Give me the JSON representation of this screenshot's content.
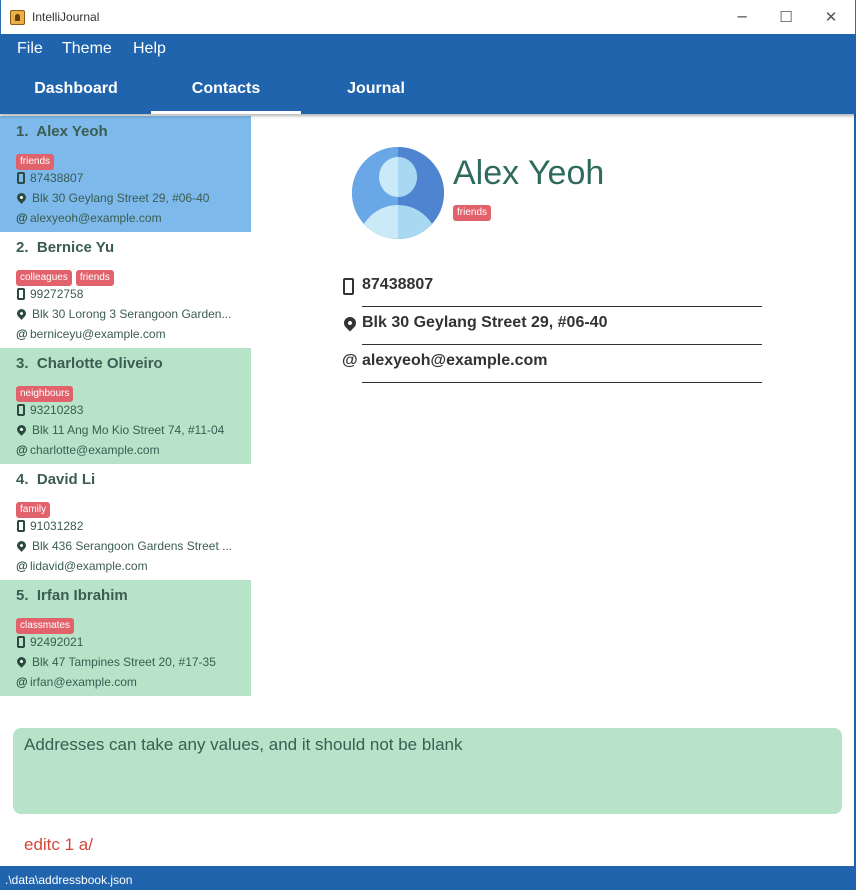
{
  "window": {
    "title": "IntelliJournal",
    "minimize": "─",
    "maximize": "☐",
    "close": "✕"
  },
  "menu": [
    "File",
    "Theme",
    "Help"
  ],
  "tabs": [
    {
      "label": "Dashboard",
      "active": false
    },
    {
      "label": "Contacts",
      "active": true
    },
    {
      "label": "Journal",
      "active": false
    }
  ],
  "contacts": [
    {
      "index": "1.",
      "name": "Alex Yeoh",
      "tags": [
        "friends"
      ],
      "phone": "87438807",
      "address": "Blk 30 Geylang Street 29, #06-40",
      "email": "alexyeoh@example.com",
      "bg": "#7db9ea",
      "selected": true
    },
    {
      "index": "2.",
      "name": "Bernice Yu",
      "tags": [
        "colleagues",
        "friends"
      ],
      "phone": "99272758",
      "address": "Blk 30 Lorong 3 Serangoon Garden...",
      "email": "berniceyu@example.com",
      "bg": "#ffffff",
      "selected": false
    },
    {
      "index": "3.",
      "name": "Charlotte Oliveiro",
      "tags": [
        "neighbours"
      ],
      "phone": "93210283",
      "address": "Blk 11 Ang Mo Kio Street 74, #11-04",
      "email": "charlotte@example.com",
      "bg": "#b7e3c8",
      "selected": false
    },
    {
      "index": "4.",
      "name": "David Li",
      "tags": [
        "family"
      ],
      "phone": "91031282",
      "address": "Blk 436 Serangoon Gardens Street ...",
      "email": "lidavid@example.com",
      "bg": "#ffffff",
      "selected": false
    },
    {
      "index": "5.",
      "name": "Irfan Ibrahim",
      "tags": [
        "classmates"
      ],
      "phone": "92492021",
      "address": "Blk 47 Tampines Street 20, #17-35",
      "email": "irfan@example.com",
      "bg": "#b7e3c8",
      "selected": false
    }
  ],
  "detail": {
    "name": "Alex Yeoh",
    "tag": "friends",
    "phone": "87438807",
    "address": "Blk 30 Geylang Street 29, #06-40",
    "email": "alexyeoh@example.com"
  },
  "icons": {
    "email": "@"
  },
  "result_message": "Addresses can take any values, and it should not be blank",
  "command_input": "editc 1 a/",
  "status_bar": ".\\data\\addressbook.json",
  "colors": {
    "brand": "#1f64ac",
    "selected": "#7db9ea",
    "alt_row": "#b7e3c8",
    "tag": "#e2626c",
    "command_text": "#d4483a"
  }
}
